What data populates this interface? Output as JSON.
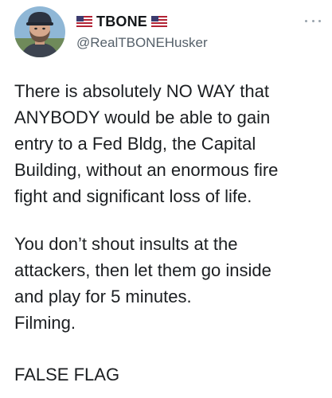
{
  "tweet": {
    "author": {
      "display_name": "TBONE",
      "handle": "@RealTBONEHusker",
      "name_emoji": "us-flag-icon"
    },
    "paragraphs": [
      "There is absolutely NO WAY that\nANYBODY would be able to gain\nentry to a Fed Bldg, the Capital\nBuilding, without an enormous fire\nfight and significant loss of life.",
      "You don’t shout insults at the\nattackers, then let them go inside\nand play for 5 minutes.\nFilming.",
      "FALSE FLAG"
    ]
  },
  "colors": {
    "text": "#1b1e21",
    "secondary_text": "#55606a",
    "flag_red": "#b22234",
    "flag_blue": "#3c3b6e"
  }
}
